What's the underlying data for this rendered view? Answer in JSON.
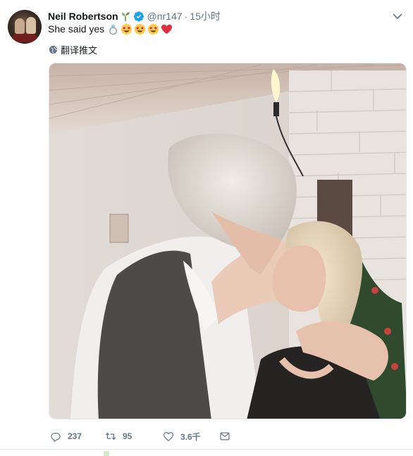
{
  "tweet": {
    "author_name": "Neil Robertson",
    "handle": "@nr147",
    "separator": "·",
    "time": "15小时",
    "text": "She said yes",
    "text_emojis": [
      "ring-emoji",
      "star-struck-emoji",
      "star-struck-emoji",
      "star-struck-emoji",
      "red-heart-emoji"
    ],
    "translate_label": "翻译推文",
    "media_description_icon": "photo",
    "actions": {
      "reply_count": "237",
      "retweet_count": "95",
      "like_count": "3.6千"
    }
  },
  "colors": {
    "text": "#14171a",
    "secondary": "#657786",
    "verified": "#1da1f2",
    "heart": "#e0245e"
  },
  "icons": [
    "sprout-icon",
    "verified-badge-icon",
    "chevron-down-icon",
    "globe-icon",
    "reply-icon",
    "retweet-icon",
    "like-icon",
    "message-icon"
  ]
}
